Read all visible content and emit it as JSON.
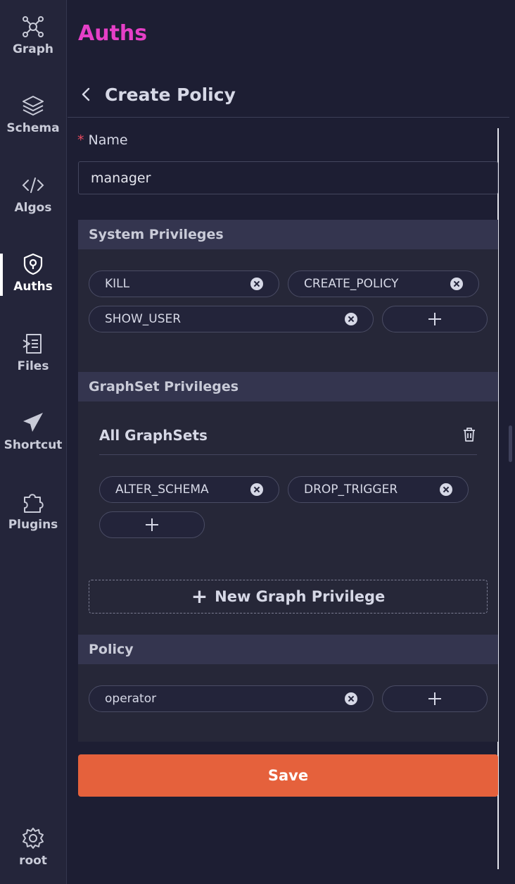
{
  "sidebar": {
    "items": [
      {
        "label": "Graph",
        "icon": "graph-icon"
      },
      {
        "label": "Schema",
        "icon": "layers-icon"
      },
      {
        "label": "Algos",
        "icon": "code-icon"
      },
      {
        "label": "Auths",
        "icon": "shield-icon",
        "active": true
      },
      {
        "label": "Files",
        "icon": "file-icon"
      },
      {
        "label": "Shortcut",
        "icon": "paper-plane-icon"
      },
      {
        "label": "Plugins",
        "icon": "puzzle-icon"
      }
    ],
    "user": {
      "label": "root",
      "icon": "gear-icon"
    }
  },
  "page": {
    "title": "Auths",
    "subtitle": "Create Policy"
  },
  "form": {
    "name_label": "Name",
    "name_value": "manager",
    "system_privileges": {
      "title": "System Privileges",
      "tags": [
        "KILL",
        "CREATE_POLICY",
        "SHOW_USER"
      ]
    },
    "graphset_privileges": {
      "title": "GraphSet Privileges",
      "group_title": "All GraphSets",
      "tags": [
        "ALTER_SCHEMA",
        "DROP_TRIGGER"
      ],
      "new_button": "New Graph Privilege"
    },
    "policy": {
      "title": "Policy",
      "tags": [
        "operator"
      ]
    },
    "save_label": "Save"
  },
  "colors": {
    "accent_title": "#e63fc7",
    "save_button": "#e5613c",
    "background": "#1d1e33",
    "required": "#e84a5f"
  }
}
